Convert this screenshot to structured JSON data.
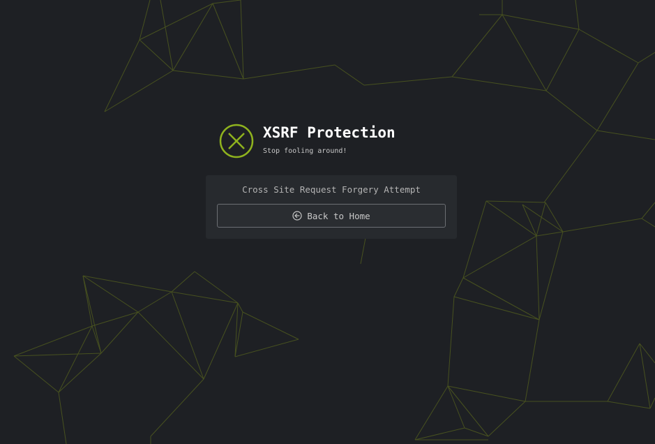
{
  "page": {
    "title": "XSRF Protection",
    "subtitle": "Stop fooling around!",
    "status_icon": "error-x-icon"
  },
  "panel": {
    "message": "Cross Site Request Forgery Attempt",
    "button": {
      "label": "Back to Home",
      "icon": "arrow-left-circle-icon"
    }
  },
  "colors": {
    "background": "#1e2024",
    "accent": "#8fb31e",
    "panel": "#272a2e"
  }
}
